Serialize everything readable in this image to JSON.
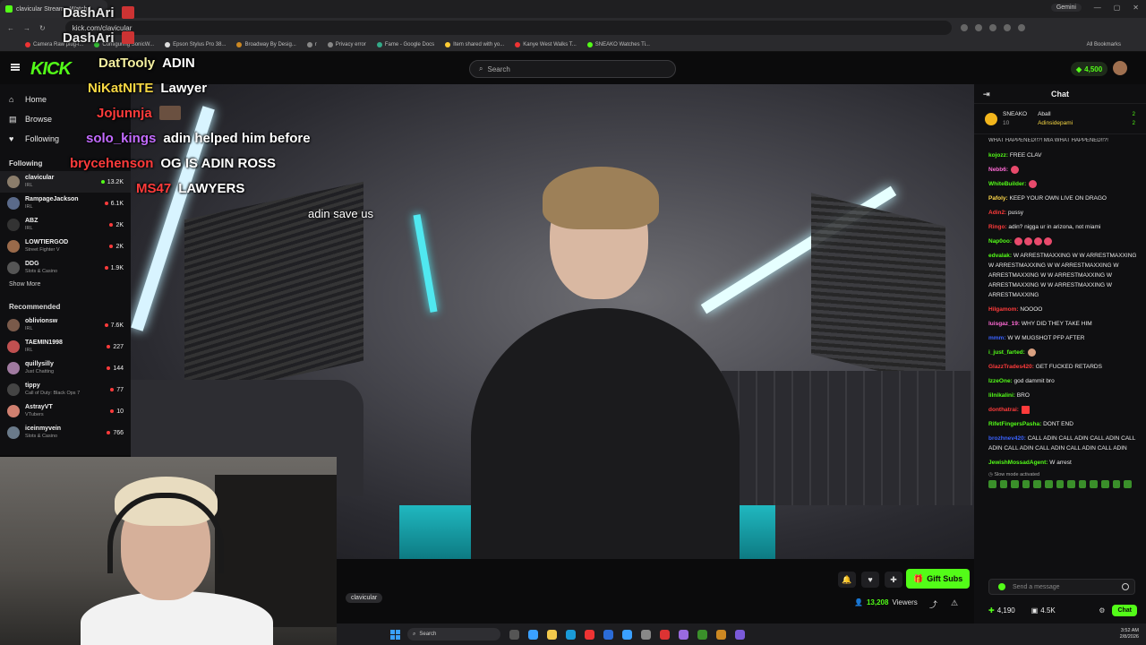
{
  "browser": {
    "tab_title": "clavicular Stream - Watch L",
    "gemini_label": "Gemini",
    "url": "kick.com/clavicular",
    "bookmarks": [
      "Camera Raw plug-i...",
      "Configuring SonicW...",
      "Epson Stylus Pro 38...",
      "Broadway By Desig...",
      "r",
      "Privacy error",
      "Fame - Google Docs",
      "Item shared with yo...",
      "Kanye West Walks T...",
      "SNEAKO Watches Ti..."
    ],
    "all_bookmarks": "All Bookmarks"
  },
  "header": {
    "logo": "KICK",
    "search_placeholder": "Search",
    "points": "4,500"
  },
  "sidebar": {
    "nav": [
      {
        "label": "Home",
        "icon": "home-icon"
      },
      {
        "label": "Browse",
        "icon": "browse-icon"
      },
      {
        "label": "Following",
        "icon": "heart-icon"
      }
    ],
    "following_title": "Following",
    "following": [
      {
        "name": "clavicular",
        "category": "IRL",
        "viewers": "13.2K"
      },
      {
        "name": "RampageJackson",
        "category": "IRL",
        "viewers": "6.1K"
      },
      {
        "name": "ABZ",
        "category": "IRL",
        "viewers": "2K"
      },
      {
        "name": "LOWTIERGOD",
        "category": "Street Fighter V",
        "viewers": "2K"
      },
      {
        "name": "DDG",
        "category": "Slots & Casino",
        "viewers": "1.9K"
      }
    ],
    "show_more": "Show More",
    "recommended_title": "Recommended",
    "recommended": [
      {
        "name": "oblivionsw",
        "category": "IRL",
        "viewers": "7.6K"
      },
      {
        "name": "TAEMIN1998",
        "category": "IRL",
        "viewers": "227"
      },
      {
        "name": "quillysilly",
        "category": "Just Chatting",
        "viewers": "144"
      },
      {
        "name": "tippy",
        "category": "Call of Duty: Black Ops 7",
        "viewers": "77"
      },
      {
        "name": "AstrayVT",
        "category": "VTubers",
        "viewers": "10"
      },
      {
        "name": "iceinmyvein",
        "category": "Slots & Casino",
        "viewers": "766"
      }
    ]
  },
  "overlay": [
    {
      "user": "DashAri",
      "msg": "",
      "color": "#e8e8e8"
    },
    {
      "user": "DashAri",
      "msg": "",
      "color": "#e8e8e8"
    },
    {
      "user": "DatTooly",
      "msg": "ADIN",
      "color": "#f5f0a0"
    },
    {
      "user": "NiKatNITE",
      "msg": "Lawyer",
      "color": "#f6d743"
    },
    {
      "user": "Jojunnja",
      "msg": "",
      "color": "#ff3b3b"
    },
    {
      "user": "solo_kings",
      "msg": "adin helped him before",
      "color": "#c36bff"
    },
    {
      "user": "brycehenson",
      "msg": "OG IS ADIN ROSS",
      "color": "#ff3b3b"
    },
    {
      "user": "MS47",
      "msg": "LAWYERS",
      "color": "#ff3b3b"
    },
    {
      "user": "",
      "msg": "adin save us",
      "color": "#3a62ff"
    }
  ],
  "below_video": {
    "tag": "clavicular",
    "gift_label": "Gift Subs",
    "viewers": "13,208",
    "viewers_label": "Viewers"
  },
  "chat": {
    "title": "Chat",
    "pinned": {
      "user": "SNEAKO",
      "sub": "10",
      "gifter1": "Aball",
      "gifter2": "Adinsidepami",
      "count1": "2",
      "count2": "2"
    },
    "messages": [
      {
        "user": "",
        "text": "WHAT HAPPENED!!?! MIA WHAT HAPPENED!!?!",
        "color": "#eaeaea"
      },
      {
        "user": "kojozz:",
        "text": "FREE CLAV",
        "color": "#53fc18"
      },
      {
        "user": "Nebb6:",
        "text": "",
        "color": "#ff6ad5"
      },
      {
        "user": "WhiteBuilder:",
        "text": "",
        "color": "#53fc18"
      },
      {
        "user": "Pafoly:",
        "text": "KEEP YOUR OWN LIVE ON DRAGO",
        "color": "#ffd84a"
      },
      {
        "user": "Adin2:",
        "text": "pussy",
        "color": "#ff3b3b"
      },
      {
        "user": "Ringo:",
        "text": "adin? nigga ur in arizona, not miami",
        "color": "#ff3b3b"
      },
      {
        "user": "Nap0oo:",
        "text": "",
        "color": "#53fc18"
      },
      {
        "user": "edvalak:",
        "text": "W ARRESTMAXXING W W ARRESTMAXXING W ARRESTMAXXING W W ARRESTMAXXING W ARRESTMAXXING W W ARRESTMAXXING W ARRESTMAXXING W W ARRESTMAXXING W ARRESTMAXXING",
        "color": "#53fc18"
      },
      {
        "user": "Hilgamom:",
        "text": "NOOOO",
        "color": "#ff3b3b"
      },
      {
        "user": "luisgaz_19:",
        "text": "WHY DID THEY TAKE HIM",
        "color": "#ff6ad5"
      },
      {
        "user": "mmm:",
        "text": "W W MUGSHOT PFP AFTER",
        "color": "#3a62ff"
      },
      {
        "user": "i_just_farted:",
        "text": "",
        "color": "#53fc18"
      },
      {
        "user": "GlazzTrades420:",
        "text": "GET FUCKED RETARDS",
        "color": "#ff3b3b"
      },
      {
        "user": "IzzeOne:",
        "text": "god dammit bro",
        "color": "#53fc18"
      },
      {
        "user": "lilnikalini:",
        "text": "BRO",
        "color": "#53fc18"
      },
      {
        "user": "donthatrai:",
        "text": "",
        "color": "#ff3b3b"
      },
      {
        "user": "RifetFingersPasha:",
        "text": "DONT END",
        "color": "#53fc18"
      },
      {
        "user": "brozhnev420:",
        "text": "CALL ADIN CALL ADIN CALL ADIN CALL ADIN CALL ADIN CALL ADIN CALL ADIN CALL ADIN",
        "color": "#3a62ff"
      },
      {
        "user": "JewishMossadAgent:",
        "text": "W arrest",
        "color": "#53fc18"
      }
    ],
    "slow_mode": "Slow mode activated",
    "input_placeholder": "Send a message",
    "points": "4,190",
    "k_points": "4.5K",
    "send_label": "Chat"
  },
  "taskbar": {
    "search": "Search",
    "time": "3:52 AM",
    "date": "2/8/2026"
  }
}
